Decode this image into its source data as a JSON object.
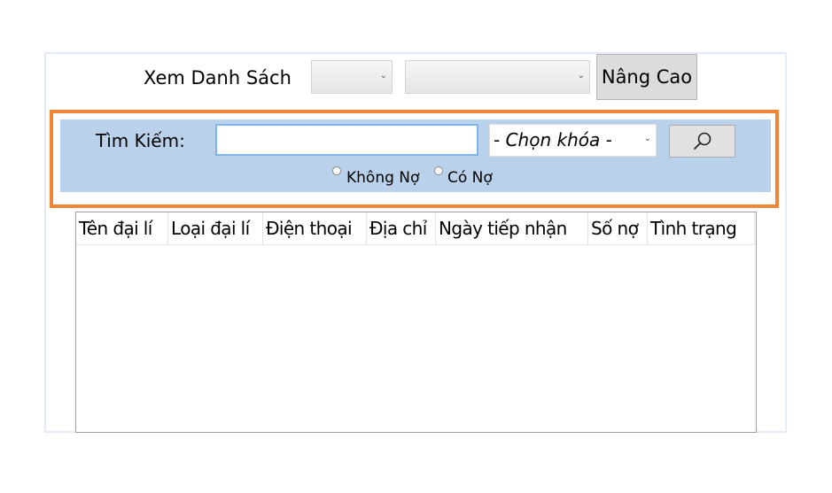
{
  "toolbar": {
    "view_list_label": "Xem Danh Sách",
    "filter_1_value": "",
    "filter_2_value": "",
    "advanced_label": "Nâng Cao"
  },
  "search": {
    "label": "Tìm Kiếm:",
    "input_value": "",
    "key_select_value": "- Chọn khóa -",
    "button_icon": "search-icon",
    "radio_options": [
      "Không Nợ",
      "Có Nợ"
    ]
  },
  "table": {
    "columns": [
      "Tên đại lí",
      "Loại đại lí",
      "Điện thoại",
      "Địa chỉ",
      "Ngày tiếp nhận",
      "Số nợ",
      "Tình trạng"
    ],
    "rows": []
  },
  "colors": {
    "highlight_border": "#ef8535",
    "search_panel_bg": "#b9d1ea",
    "input_border": "#7eb4ea"
  }
}
